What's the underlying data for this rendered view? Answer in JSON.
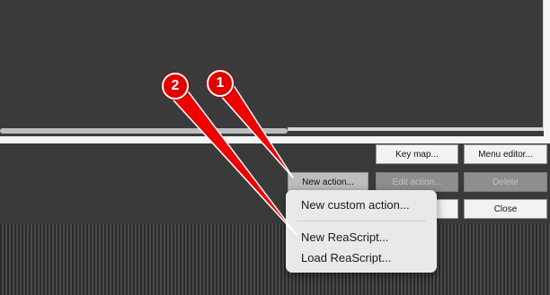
{
  "buttons": {
    "key_map": "Key map...",
    "menu_editor": "Menu editor...",
    "new_action": "New action...",
    "edit_action": "Edit action...",
    "delete": "Delete",
    "close": "Close"
  },
  "popup_menu": {
    "items": [
      "New custom action...",
      "New ReaScript...",
      "Load ReaScript..."
    ]
  },
  "annotations": {
    "badge_1": "1",
    "badge_2": "2"
  },
  "colors": {
    "badge_red": "#e00000",
    "background": "#3a3a3a"
  }
}
